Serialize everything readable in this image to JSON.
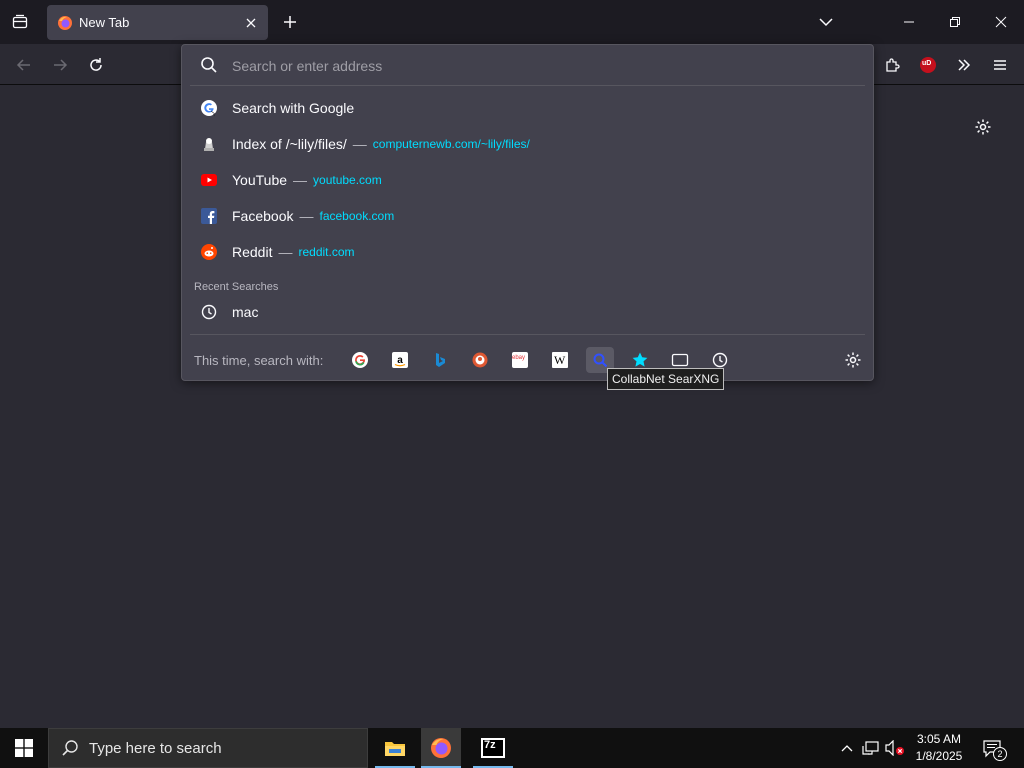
{
  "tab": {
    "title": "New Tab"
  },
  "urlbar": {
    "placeholder": "Search or enter address",
    "results": [
      {
        "title": "Search with Google",
        "url": "",
        "icon": "google-icon"
      },
      {
        "title": "Index of /~lily/files/",
        "url": "computernewb.com/~lily/files/",
        "icon": "site-icon"
      },
      {
        "title": "YouTube",
        "url": "youtube.com",
        "icon": "youtube-icon"
      },
      {
        "title": "Facebook",
        "url": "facebook.com",
        "icon": "facebook-icon"
      },
      {
        "title": "Reddit",
        "url": "reddit.com",
        "icon": "reddit-icon"
      }
    ],
    "separator": "—",
    "recent_label": "Recent Searches",
    "recent": [
      {
        "title": "mac",
        "icon": "clock-icon"
      }
    ],
    "oneoff_label": "This time, search with:",
    "engines": [
      {
        "name": "google",
        "icon": "google-icon"
      },
      {
        "name": "amazon",
        "icon": "amazon-icon"
      },
      {
        "name": "bing",
        "icon": "bing-icon"
      },
      {
        "name": "duckduckgo",
        "icon": "duckduckgo-icon"
      },
      {
        "name": "ebay",
        "icon": "ebay-icon",
        "text": "ebay"
      },
      {
        "name": "wikipedia",
        "icon": "wikipedia-icon",
        "text": "W"
      },
      {
        "name": "searxng",
        "icon": "searxng-icon",
        "active": true
      },
      {
        "name": "bookmarks",
        "icon": "star-icon"
      },
      {
        "name": "tabs",
        "icon": "tab-icon"
      },
      {
        "name": "history",
        "icon": "clock-icon"
      }
    ],
    "tooltip": "CollabNet SearXNG"
  },
  "taskbar": {
    "search_placeholder": "Type here to search",
    "time": "3:05 AM",
    "date": "1/8/2025",
    "notifications": "2",
    "sevenzip_label": "7z"
  },
  "toolbar": {
    "ublock_label": "uD"
  },
  "colors": {
    "accent_url": "#00ddff",
    "panel_bg": "#42414d",
    "toolbar_bg": "#2b2a33",
    "taskbar_bg": "#101010"
  }
}
